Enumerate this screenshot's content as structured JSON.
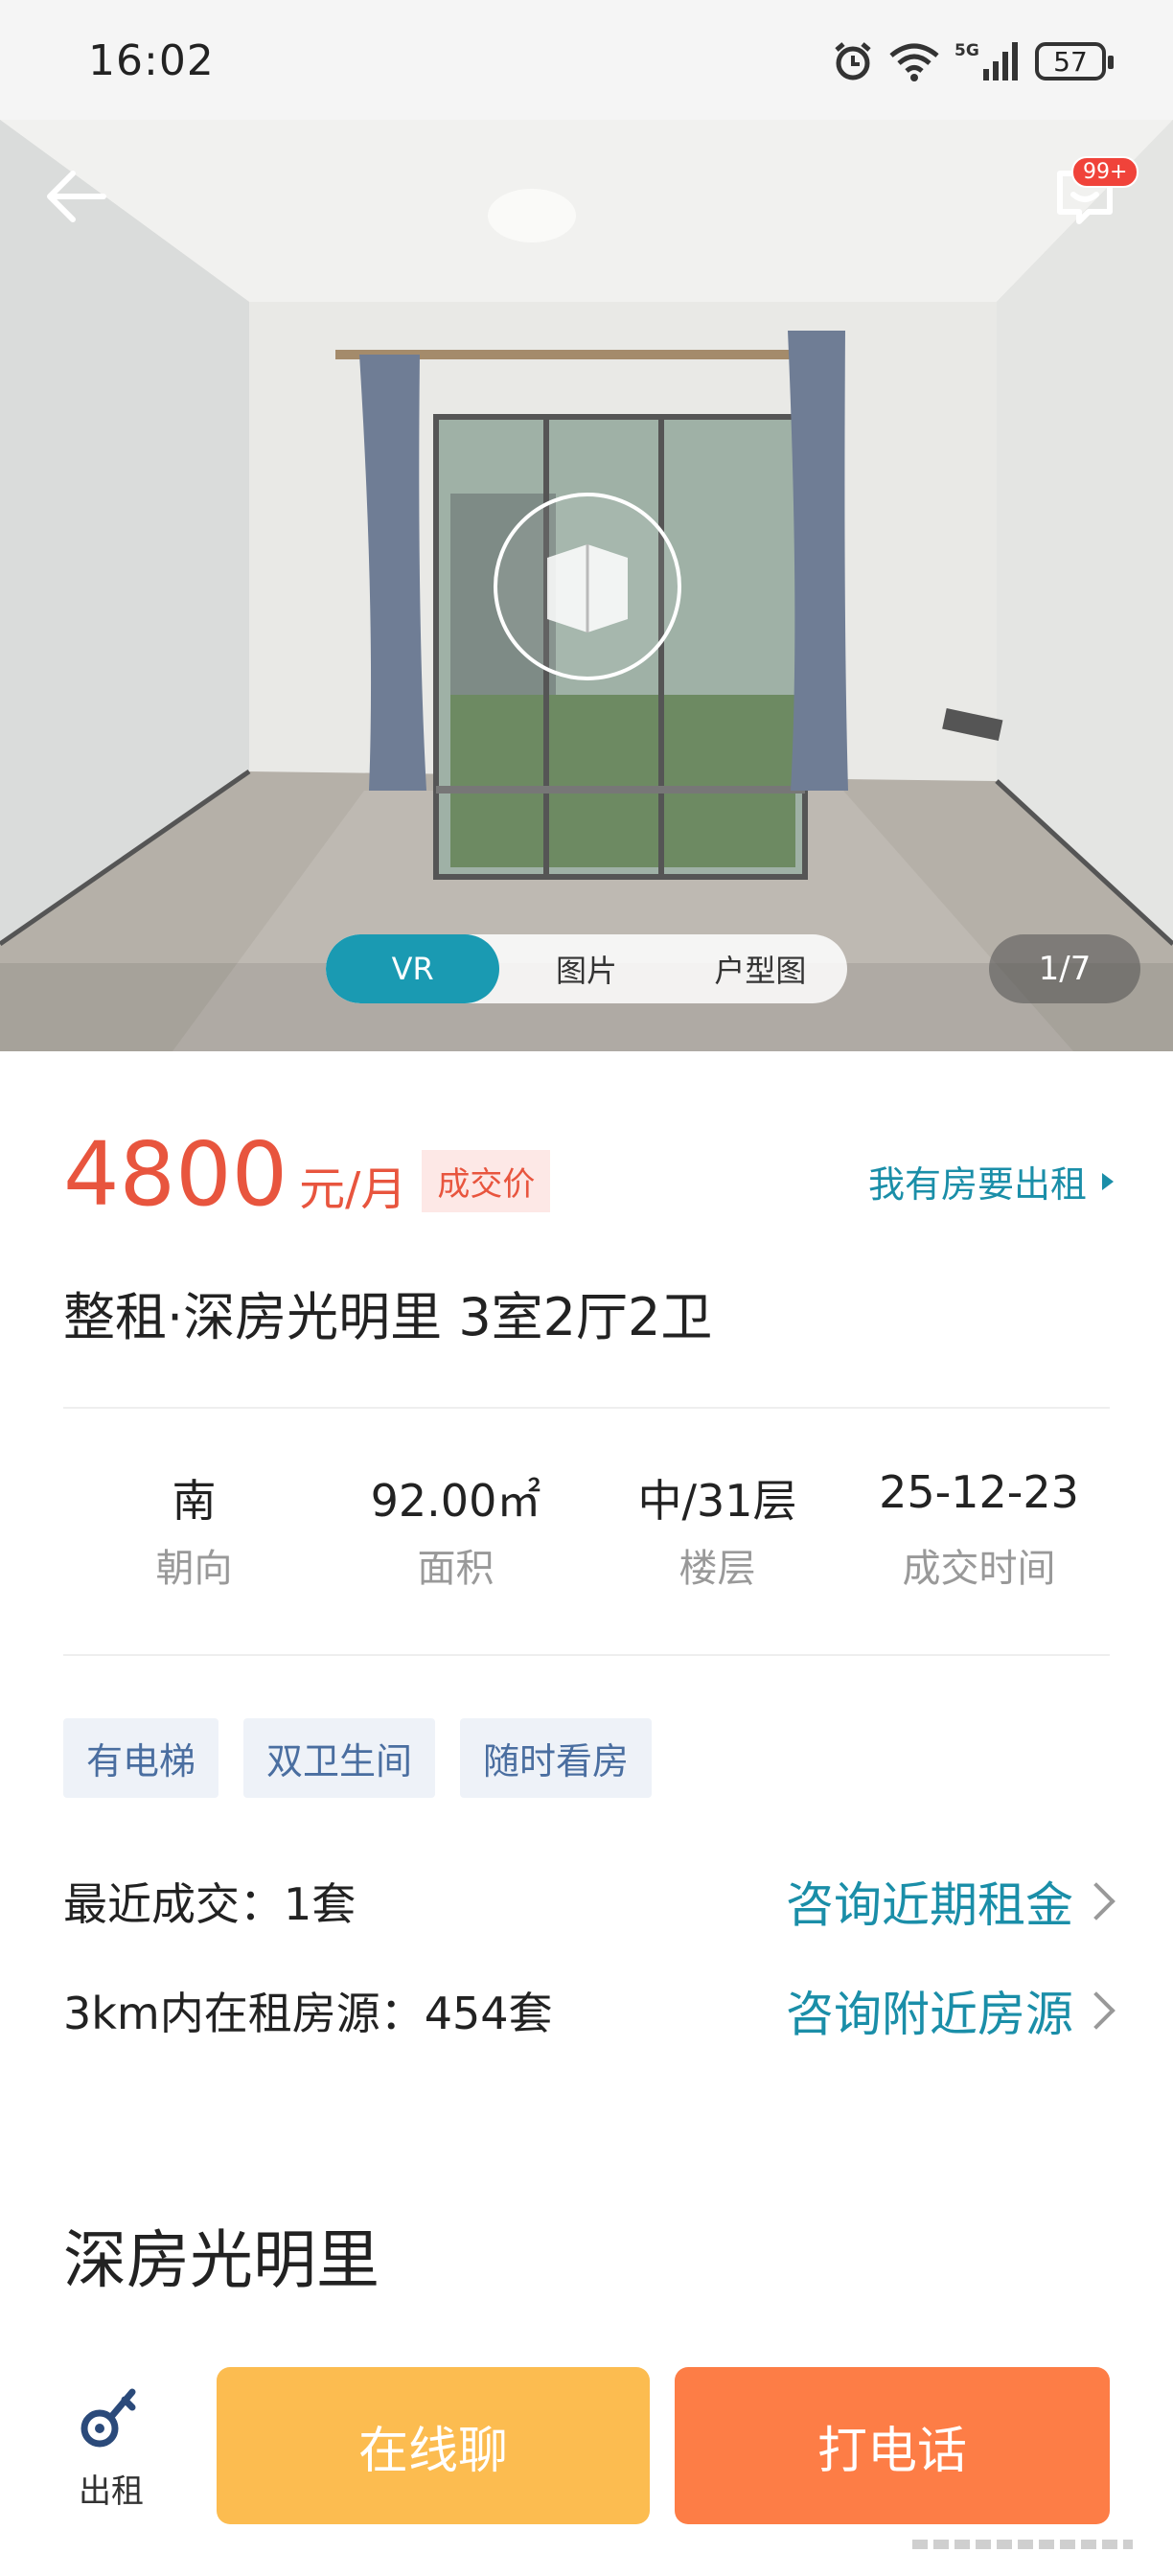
{
  "status_bar": {
    "time": "16:02",
    "battery": "57"
  },
  "hero": {
    "notification_badge": "99+",
    "media_tabs": [
      {
        "label": "VR",
        "active": true
      },
      {
        "label": "图片",
        "active": false
      },
      {
        "label": "户型图",
        "active": false
      }
    ],
    "counter": "1/7"
  },
  "listing": {
    "price": "4800",
    "price_unit": "元/月",
    "price_tag": "成交价",
    "rent_out_link": "我有房要出租",
    "title": "整租·深房光明里 3室2厅2卫",
    "stats": [
      {
        "value": "南",
        "label": "朝向"
      },
      {
        "value": "92.00㎡",
        "label": "面积"
      },
      {
        "value": "中/31层",
        "label": "楼层"
      },
      {
        "value": "25-12-23",
        "label": "成交时间"
      }
    ],
    "tags": [
      "有电梯",
      "双卫生间",
      "随时看房"
    ],
    "recent_deal": "最近成交：1套",
    "recent_deal_link": "咨询近期租金",
    "nearby": "3km内在租房源：454套",
    "nearby_link": "咨询附近房源"
  },
  "community": {
    "name": "深房光明里"
  },
  "bottom_bar": {
    "rent_label": "出租",
    "chat_label": "在线聊",
    "call_label": "打电话"
  },
  "colors": {
    "accent_teal": "#1a9ab2",
    "price_red": "#e8553e",
    "chat_yellow": "#fcbc50",
    "call_orange": "#fd7d46"
  }
}
